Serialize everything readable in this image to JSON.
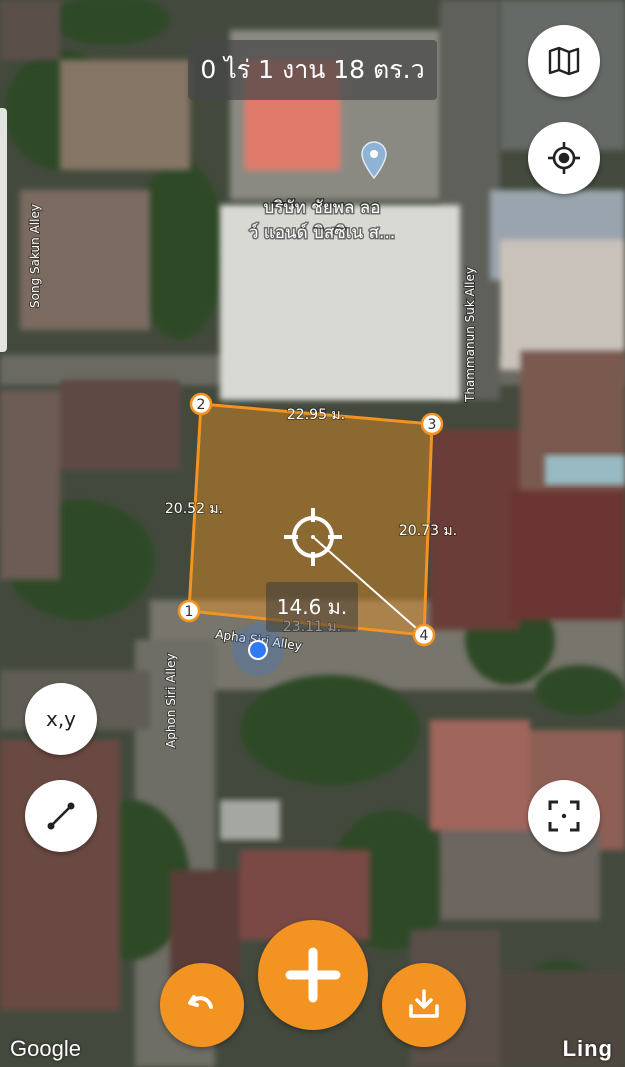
{
  "area_label": "0 ไร่ 1 งาน 18 ตร.ว",
  "poi": {
    "name_line1": "บริษัท ชัยพล ลอ",
    "name_line2": "ว์ แอนด์ บิสซิเน ส...",
    "pin_icon": "location-pin-icon"
  },
  "roads": {
    "song_sakun": "Song Sakun Alley",
    "thammanun": "Thammanun Suk Alley",
    "aphon_siri_vertical": "Aphon Siri Alley",
    "aphon_siri_horizontal": "Apha Siri Alley"
  },
  "polygon": {
    "vertices": [
      {
        "label": "1"
      },
      {
        "label": "2"
      },
      {
        "label": "3"
      },
      {
        "label": "4"
      }
    ],
    "edges": {
      "top": "22.95 ม.",
      "left": "20.52 ม.",
      "right": "20.73 ม.",
      "bottom": "23.11 ม."
    },
    "measure_distance": "14.6 ม.",
    "fill_color": "#f39321",
    "stroke_color": "#f39321"
  },
  "buttons": {
    "map_layers": {
      "icon": "map-icon"
    },
    "locate": {
      "icon": "crosshair-locate-icon"
    },
    "coordinates": {
      "label": "x,y"
    },
    "measure_line": {
      "icon": "line-measure-icon"
    },
    "fit_view": {
      "icon": "fit-screen-icon"
    },
    "undo": {
      "icon": "undo-icon"
    },
    "add_point": {
      "icon": "plus-icon"
    },
    "save": {
      "icon": "download-icon"
    }
  },
  "attribution": {
    "google": "Google",
    "brand": "Ling"
  },
  "colors": {
    "accent": "#f39321",
    "user_location": "#2f7bf5"
  }
}
